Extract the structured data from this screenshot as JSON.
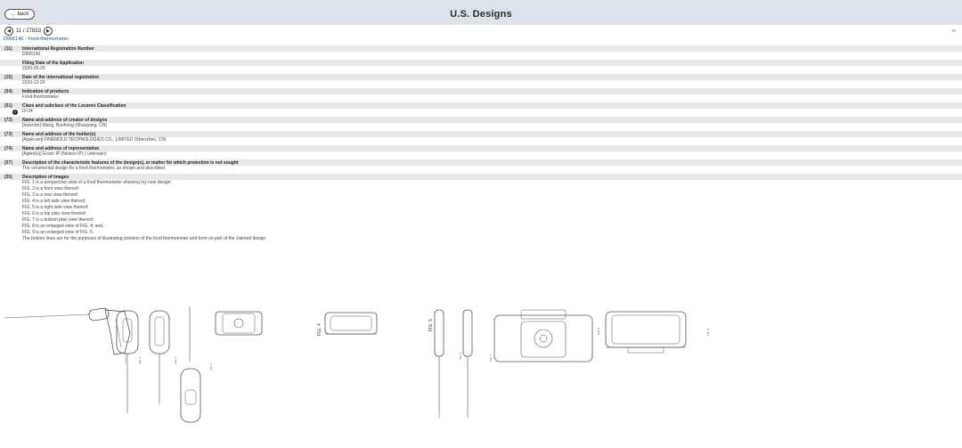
{
  "header": {
    "back_label": "← back",
    "title": "U.S. Designs"
  },
  "pager": {
    "prev_icon": "◀",
    "next_icon": "▶",
    "text": "11 / 27833"
  },
  "doc_link": "D906140 - Food thermometer",
  "external_icon": "∞",
  "fields": [
    {
      "code": "(11)",
      "label": "International Registration Number",
      "value": "D906140"
    },
    {
      "code": "",
      "label": "Filing Date of the Application",
      "value": "2020-05-20"
    },
    {
      "code": "(15)",
      "label": "Date of the international registration",
      "value": "2020-12-29"
    },
    {
      "code": "(54)",
      "label": "Indication of products",
      "value": "Food thermometer"
    },
    {
      "code": "(51)",
      "label": "Class and subclass of the Locarno Classification",
      "value": "10-04"
    },
    {
      "code": "(72)",
      "label": "Name and address of creator of designs",
      "value": "[Inventor] Wang, Baohong (Shaoyang, CN)"
    },
    {
      "code": "(73)",
      "label": "Name and address of the holder(s)",
      "value": "[Applicant] FINEMOLD TECHNOLOGIES CO., LIMITED (Shenzhen, CN)"
    },
    {
      "code": "(74)",
      "label": "Name and address of representative",
      "value": "[Agent(s)] Erson IP (Nelson IP) ( unknown)"
    },
    {
      "code": "(57)",
      "label": "Description of the characteristic features of the design(s), or matter for which protection is not sought",
      "value": "The ornamental design for a food thermometer, as shown and described."
    }
  ],
  "images_section": {
    "code": "(55)",
    "label": "Description of images",
    "lines": [
      "FIG. 1 is a perspective view of a food thermometer showing my new design;",
      "FIG. 2 is a front view thereof;",
      "FIG. 3 is a rear view thereof;",
      "FIG. 4 is a left side view thereof;",
      "FIG. 5 is a right side view thereof;",
      "FIG. 6 is a top plan view thereof;",
      "FIG. 7 is a bottom plan view thereof;",
      "FIG. 8 is an enlarged view of FIG. 4; and,",
      "FIG. 9 is an enlarged view of FIG. 5.",
      "The broken lines are for the purposes of illustrating portions of the food thermometer and form no part of the claimed design."
    ]
  },
  "figure_labels": {
    "fig2": "FIG. 2",
    "fig3": "FIG. 3",
    "fig4": "FIG. 4",
    "fig5": "FIG. 5",
    "fig6": "FIG. 6",
    "fig7": "FIG. 7",
    "fig8": "FIG. 8",
    "fig9": "FIG. 9"
  }
}
